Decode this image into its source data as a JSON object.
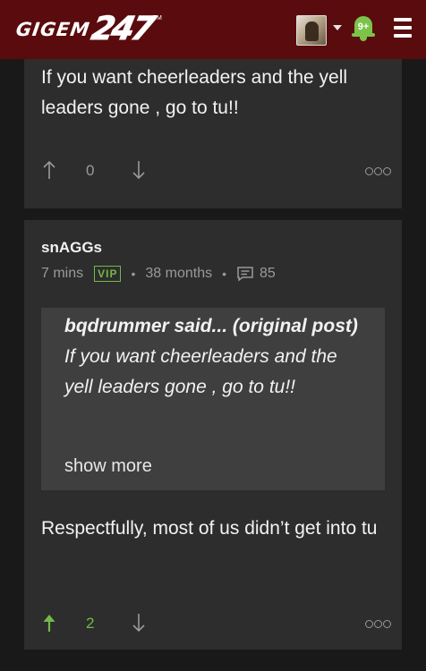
{
  "header": {
    "logo_text": "GIGEM",
    "logo_number": "247",
    "logo_tm": "TM",
    "notification_count": "9+",
    "icons": [
      "avatar",
      "chevron-down-icon",
      "bell-icon",
      "menu-icon"
    ]
  },
  "post1": {
    "body": "If you want cheerleaders and the yell leaders gone , go to tu!!",
    "votes": "0",
    "icons": [
      "upvote-icon",
      "downvote-icon",
      "more-options-icon"
    ]
  },
  "post2": {
    "author": "snAGGs",
    "time": "7 mins",
    "badge": "VIP",
    "tenure": "38 months",
    "post_count": "85",
    "quote": {
      "author": "bqdrummer said... (original post)",
      "text": " If you want cheerleaders and the yell leaders gone , go to tu!!",
      "show_more": "show more"
    },
    "body": "Respectfully, most of us didn’t get into tu",
    "votes": "2",
    "upvote_color": "#72b84a"
  },
  "colors": {
    "header_bg": "#5a0b0d",
    "page_bg": "#191919",
    "card_bg": "#2d2d2d",
    "quote_bg": "#3f3f3f",
    "accent_green": "#72b84a"
  }
}
